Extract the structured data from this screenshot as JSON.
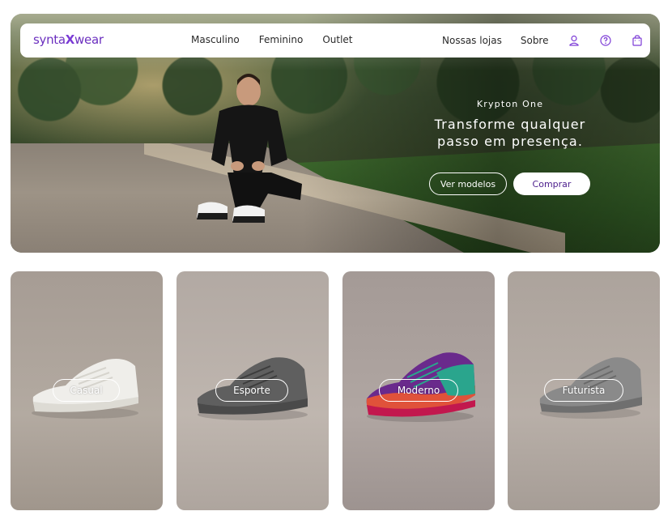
{
  "brand": {
    "name_prefix": "synta",
    "name_x": "X",
    "name_suffix": "wear",
    "color": "#6b2fbf"
  },
  "nav": {
    "center_links": [
      "Masculino",
      "Feminino",
      "Outlet"
    ],
    "right_links": [
      "Nossas lojas",
      "Sobre"
    ],
    "icons": [
      "user-icon",
      "help-icon",
      "shopping-bag-icon"
    ],
    "icon_color": "#7b3ad6"
  },
  "hero": {
    "eyebrow": "Krypton One",
    "headline_line1": "Transforme qualquer",
    "headline_line2": "passo em presença.",
    "secondary_button": "Ver modelos",
    "primary_button": "Comprar"
  },
  "categories": [
    {
      "label": "Casual",
      "shoe_color": "#efeeea"
    },
    {
      "label": "Esporte",
      "shoe_color": "#5b5b5b"
    },
    {
      "label": "Moderno",
      "shoe_color": "#6a2a8c"
    },
    {
      "label": "Futurista",
      "shoe_color": "#8a8a8a"
    }
  ]
}
